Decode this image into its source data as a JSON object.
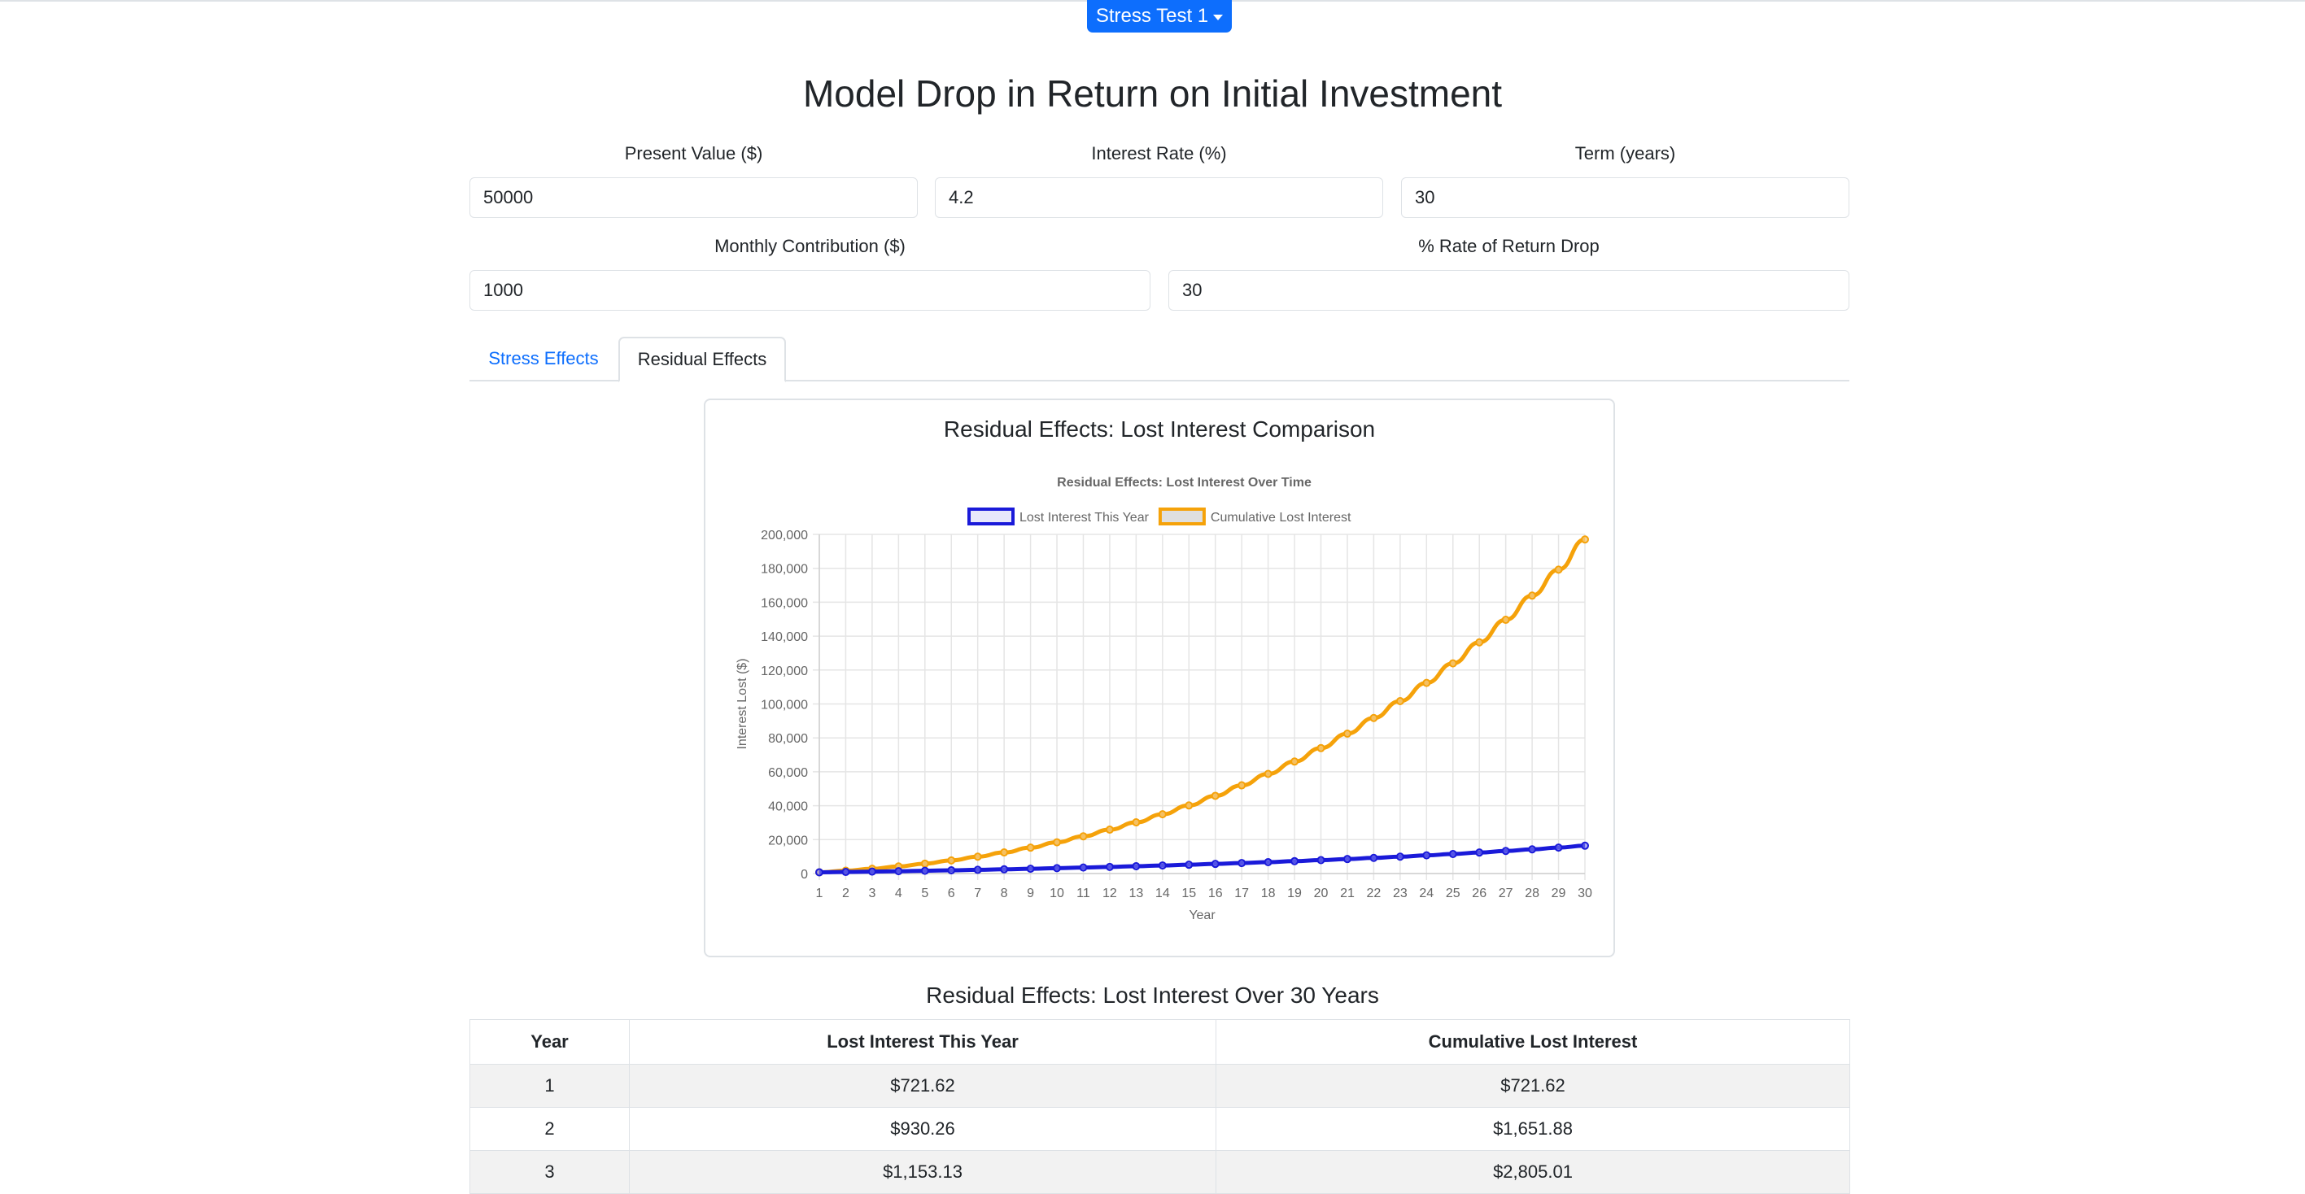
{
  "header": {
    "dropdown_label": "Stress Test 1",
    "title": "Model Drop in Return on Initial Investment"
  },
  "form": {
    "present_value": {
      "label": "Present Value ($)",
      "value": "50000"
    },
    "interest_rate": {
      "label": "Interest Rate (%)",
      "value": "4.2"
    },
    "term": {
      "label": "Term (years)",
      "value": "30"
    },
    "monthly_contribution": {
      "label": "Monthly Contribution ($)",
      "value": "1000"
    },
    "rate_drop": {
      "label": "% Rate of Return Drop",
      "value": "30"
    }
  },
  "tabs": [
    {
      "label": "Stress Effects",
      "active": false
    },
    {
      "label": "Residual Effects",
      "active": true
    }
  ],
  "chart_card": {
    "title": "Residual Effects: Lost Interest Comparison"
  },
  "chart_data": {
    "type": "line",
    "title": "Residual Effects: Lost Interest Over Time",
    "xlabel": "Year",
    "ylabel": "Interest Lost ($)",
    "x": [
      1,
      2,
      3,
      4,
      5,
      6,
      7,
      8,
      9,
      10,
      11,
      12,
      13,
      14,
      15,
      16,
      17,
      18,
      19,
      20,
      21,
      22,
      23,
      24,
      25,
      26,
      27,
      28,
      29,
      30
    ],
    "ylim": [
      0,
      200000
    ],
    "yticks": [
      0,
      20000,
      40000,
      60000,
      80000,
      100000,
      120000,
      140000,
      160000,
      180000,
      200000
    ],
    "ytick_labels": [
      "0",
      "20,000",
      "40,000",
      "60,000",
      "80,000",
      "100,000",
      "120,000",
      "140,000",
      "160,000",
      "180,000",
      "200,000"
    ],
    "grid": true,
    "legend_position": "top",
    "series": [
      {
        "name": "Lost Interest This Year",
        "color": "#1a1ad9",
        "values": [
          722,
          930,
          1153,
          1390,
          1640,
          1910,
          2200,
          2500,
          2820,
          3170,
          3530,
          3910,
          4320,
          4750,
          5200,
          5680,
          6190,
          6730,
          7300,
          7910,
          8550,
          9230,
          9950,
          10720,
          11530,
          12390,
          13300,
          14270,
          15300,
          16400
        ]
      },
      {
        "name": "Cumulative Lost Interest",
        "color": "#f5a20a",
        "values": [
          722,
          1652,
          2805,
          4195,
          5835,
          7745,
          9945,
          12445,
          15265,
          18435,
          21965,
          25875,
          30195,
          34945,
          40145,
          45825,
          52015,
          58745,
          66045,
          73955,
          82505,
          91735,
          101685,
          112405,
          123935,
          136325,
          149625,
          163895,
          179195,
          197000
        ]
      }
    ]
  },
  "table": {
    "title": "Residual Effects: Lost Interest Over 30 Years",
    "headers": [
      "Year",
      "Lost Interest This Year",
      "Cumulative Lost Interest"
    ],
    "rows": [
      [
        "1",
        "$721.62",
        "$721.62"
      ],
      [
        "2",
        "$930.26",
        "$1,651.88"
      ],
      [
        "3",
        "$1,153.13",
        "$2,805.01"
      ]
    ]
  }
}
